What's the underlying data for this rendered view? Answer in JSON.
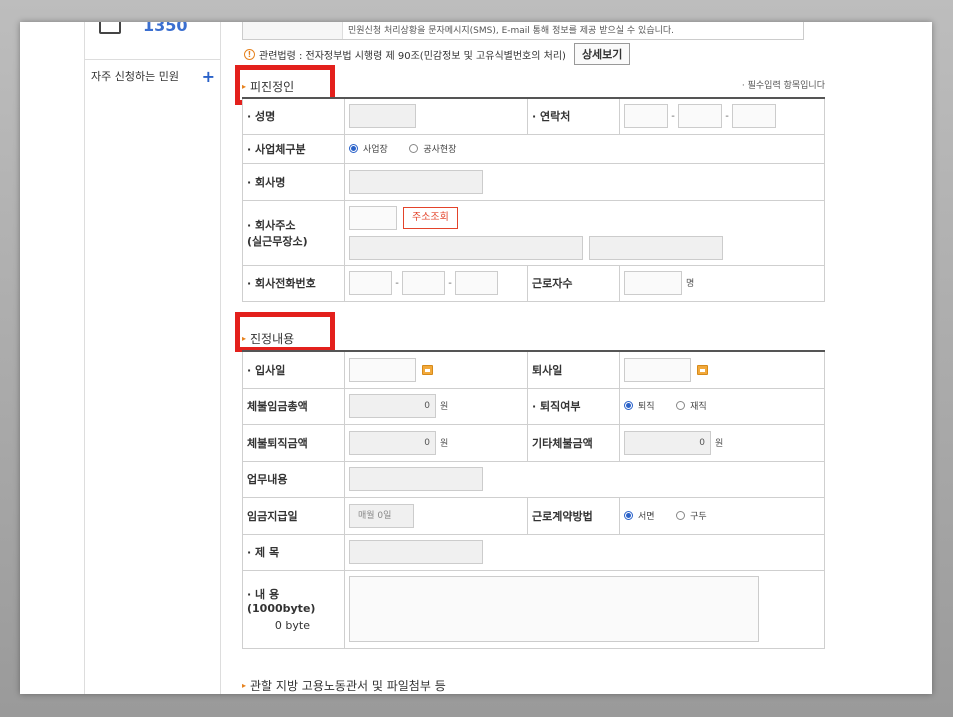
{
  "sidebar": {
    "phone_number": "1350",
    "faq_label": "자주 신청하는 민원",
    "faq_plus": "+"
  },
  "notice": {
    "text": "민원신청 처리상황을 문자메시지(SMS), E-mail 통해 정보를 제공 받으실 수 있습니다.",
    "law_text": "관련법령 : 전자정부법 시행령 제 90조(민감정보 및 고유식별번호의 처리)",
    "detail_button": "상세보기",
    "warn_glyph": "!"
  },
  "respondent": {
    "title": "피진정인",
    "required_note": "· 필수입력 항목입니다",
    "name_label": "· 성명",
    "contact_label": "· 연락처",
    "biz_type_label": "· 사업체구분",
    "biz_type_options": [
      "사업장",
      "공사현장"
    ],
    "biz_type_selected": "사업장",
    "company_label": "· 회사명",
    "address_label_1": "· 회사주소",
    "address_label_2": "(실근무장소)",
    "address_button": "주소조회",
    "phone_label": "· 회사전화번호",
    "workers_label": "근로자수",
    "workers_unit": "명"
  },
  "petition": {
    "title": "진정내용",
    "hire_date_label": "· 입사일",
    "leave_date_label": "퇴사일",
    "unpaid_wage_label": "체불임금총액",
    "unpaid_wage_value": "0",
    "retire_status_label": "· 퇴직여부",
    "retire_options": [
      "퇴직",
      "재직"
    ],
    "retire_selected": "퇴직",
    "unpaid_severance_label": "체불퇴직금액",
    "unpaid_severance_value": "0",
    "other_unpaid_label": "기타체불금액",
    "other_unpaid_value": "0",
    "currency_unit": "원",
    "job_label": "업무내용",
    "payday_label": "임금지급일",
    "payday_placeholder": "매월 0일",
    "contract_label": "근로계약방법",
    "contract_options": [
      "서면",
      "구두"
    ],
    "contract_selected": "서면",
    "subject_label": "· 제 목",
    "content_label": "· 내 용(1000byte)",
    "byte_count": "0 byte"
  },
  "footer": {
    "title": "관할 지방 고용노동관서 및 파일첨부 등"
  },
  "colors": {
    "highlight_box": "#e3201c",
    "accent_orange": "#e6821e",
    "radio_blue": "#2a62c9"
  }
}
